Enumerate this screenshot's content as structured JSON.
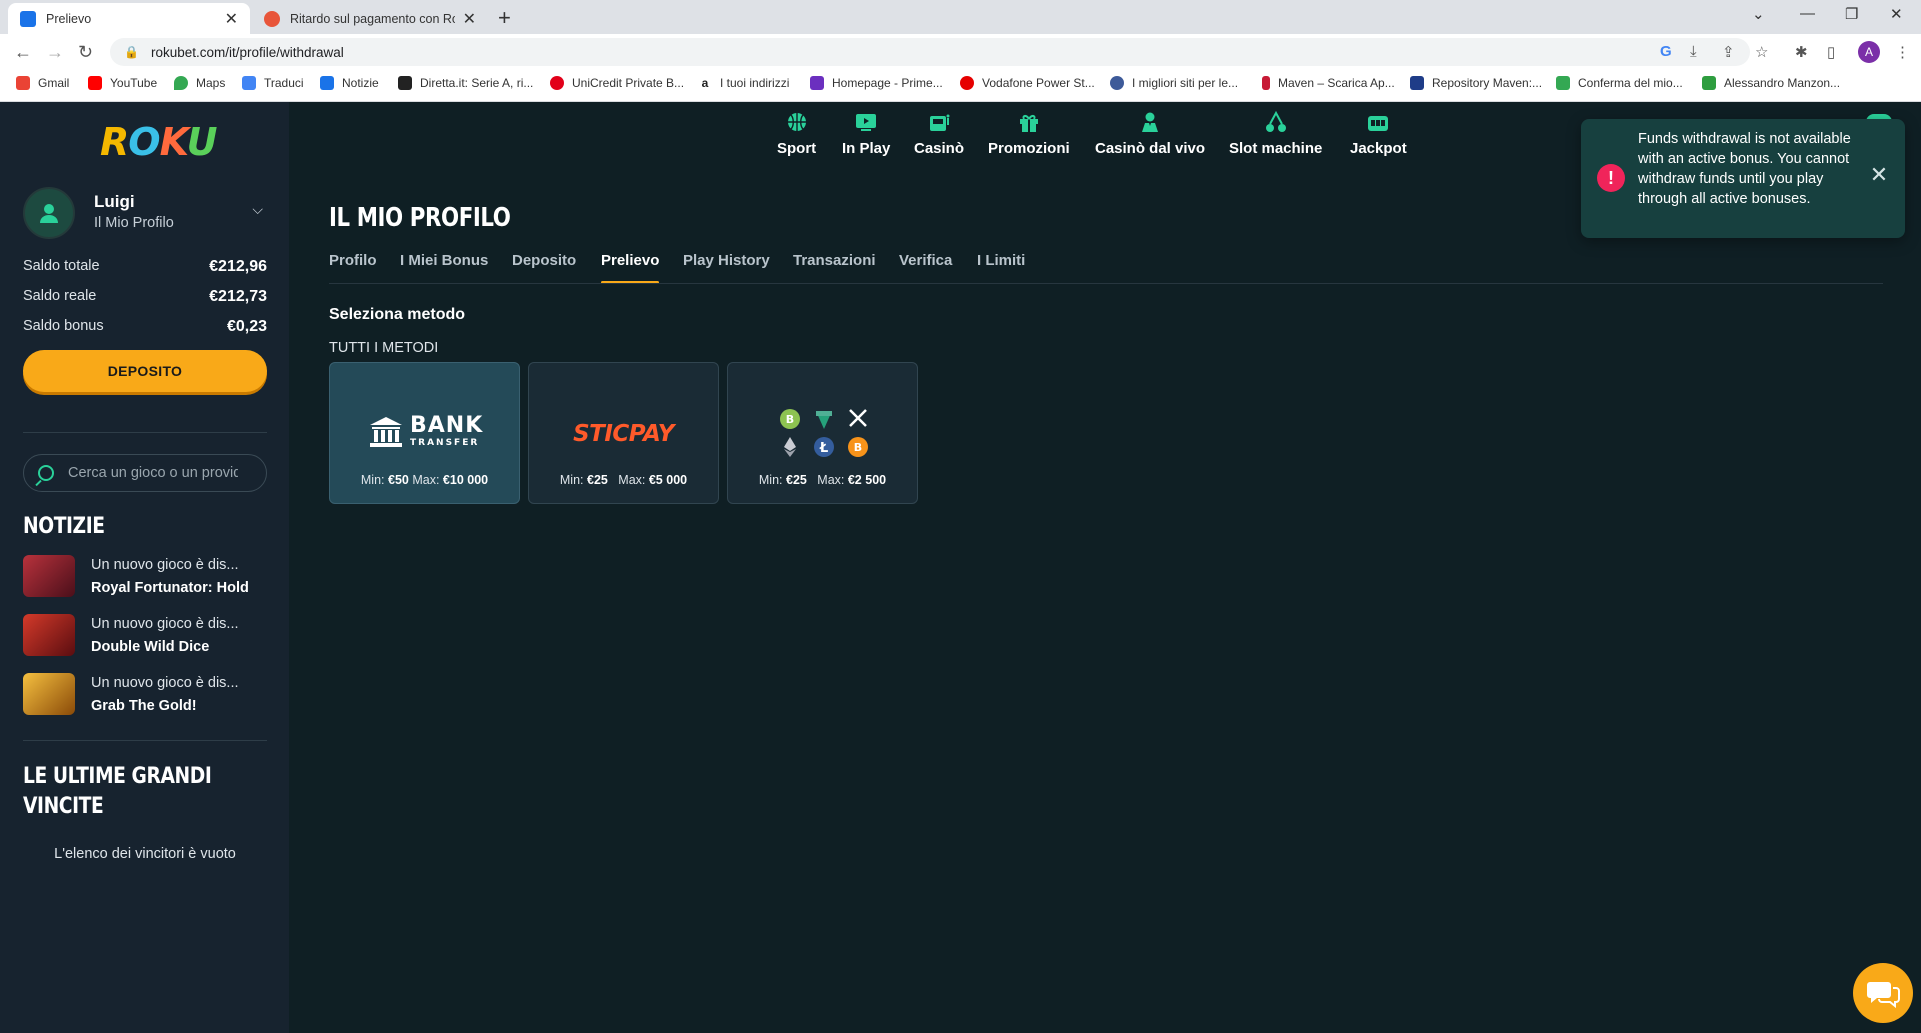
{
  "browser": {
    "tabs": [
      {
        "title": "Prelievo",
        "favicon_color": "#1a73e8",
        "active": true
      },
      {
        "title": "Ritardo sul pagamento con Roku",
        "favicon_color": "#e8553a",
        "active": false
      }
    ],
    "url": "rokubet.com/it/profile/withdrawal",
    "profile_initial": "A",
    "bookmarks": [
      {
        "label": "Gmail",
        "color": "#ea4335"
      },
      {
        "label": "YouTube",
        "color": "#ff0000"
      },
      {
        "label": "Maps",
        "color": "#34a853"
      },
      {
        "label": "Traduci",
        "color": "#4285f4"
      },
      {
        "label": "Notizie",
        "color": "#1a73e8"
      },
      {
        "label": "Diretta.it: Serie A, ri...",
        "color": "#222222"
      },
      {
        "label": "UniCredit Private B...",
        "color": "#e2001a"
      },
      {
        "label": "I tuoi indirizzi",
        "color": "#222222"
      },
      {
        "label": "Homepage - Prime...",
        "color": "#6b2fbf"
      },
      {
        "label": "Vodafone Power St...",
        "color": "#e60000"
      },
      {
        "label": "I migliori siti per le...",
        "color": "#3d5a99"
      },
      {
        "label": "Maven – Scarica Ap...",
        "color": "#c71a36"
      },
      {
        "label": "Repository Maven:...",
        "color": "#1f3c88"
      },
      {
        "label": "Conferma del mio...",
        "color": "#34a853"
      },
      {
        "label": "Alessandro Manzon...",
        "color": "#2e9d3f"
      }
    ]
  },
  "sidebar": {
    "logo": {
      "p1": "R",
      "p2": "O",
      "p3": "K",
      "p4": "U"
    },
    "user": {
      "name": "Luigi",
      "subtitle": "Il Mio Profilo"
    },
    "balances": [
      {
        "label": "Saldo totale",
        "value": "€212,96"
      },
      {
        "label": "Saldo reale",
        "value": "€212,73"
      },
      {
        "label": "Saldo bonus",
        "value": "€0,23"
      }
    ],
    "deposit_label": "DEPOSITO",
    "search_placeholder": "Cerca un gioco o un provider",
    "news_title": "NOTIZIE",
    "news": [
      {
        "line1": "Un nuovo gioco è dis...",
        "line2": "Royal Fortunator: Hold",
        "thumb_color": "#7a1e2a"
      },
      {
        "line1": "Un nuovo gioco è dis...",
        "line2": "Double Wild Dice",
        "thumb_color": "#8c1a1a"
      },
      {
        "line1": "Un nuovo gioco è dis...",
        "line2": "Grab The Gold!",
        "thumb_color": "#b06a12"
      }
    ],
    "winners_title_line1": "LE ULTIME GRANDI",
    "winners_title_line2": "VINCITE",
    "winners_empty": "L'elenco dei vincitori è vuoto"
  },
  "topnav": [
    {
      "label": "Sport",
      "icon": "basketball-icon"
    },
    {
      "label": "In Play",
      "icon": "play-screen-icon"
    },
    {
      "label": "Casinò",
      "icon": "slot-robot-icon"
    },
    {
      "label": "Promozioni",
      "icon": "gift-icon"
    },
    {
      "label": "Casinò dal vivo",
      "icon": "dealer-icon"
    },
    {
      "label": "Slot machine",
      "icon": "cherries-icon"
    },
    {
      "label": "Jackpot",
      "icon": "jackpot-icon"
    }
  ],
  "profile": {
    "title": "IL MIO PROFILO",
    "tabs": [
      "Profilo",
      "I Miei Bonus",
      "Deposito",
      "Prelievo",
      "Play History",
      "Transazioni",
      "Verifica",
      "I Limiti"
    ],
    "active_tab": "Prelievo",
    "select_title": "Seleziona metodo",
    "all_methods": "TUTTI I METODI",
    "methods": [
      {
        "name": "BANK",
        "sub": "TRANSFER",
        "min_label": "Min:",
        "min": "€50",
        "max_label": "Max:",
        "max": "€10 000"
      },
      {
        "name": "STICPAY",
        "min_label": "Min:",
        "min": "€25",
        "max_label": "Max:",
        "max": "€5 000"
      },
      {
        "name": "crypto",
        "min_label": "Min:",
        "min": "€25",
        "max_label": "Max:",
        "max": "€2 500"
      }
    ]
  },
  "toast": {
    "message": "Funds withdrawal is not available with an active bonus. You cannot withdraw funds until you play through all active bonuses.",
    "close": "✕",
    "icon_glyph": "!"
  },
  "colors": {
    "accent": "#2ad19a",
    "cta": "#f9a918",
    "toast_bg": "#17403f",
    "error": "#f0245a"
  }
}
